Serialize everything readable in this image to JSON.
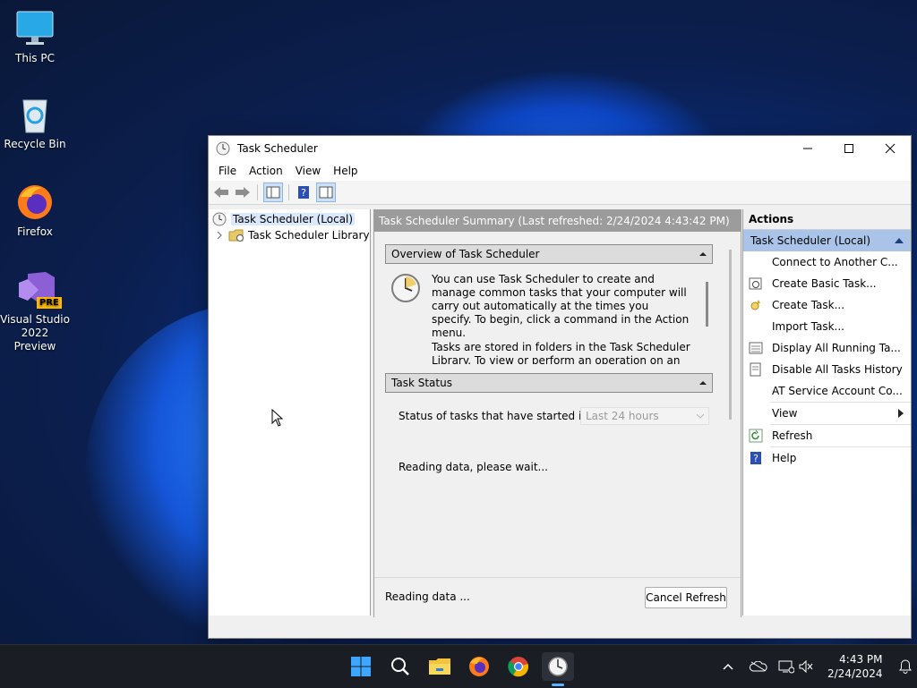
{
  "desktop": {
    "icons": [
      {
        "label": "This PC"
      },
      {
        "label": "Recycle Bin"
      },
      {
        "label": "Firefox"
      },
      {
        "label": "Visual Studio 2022 Preview",
        "badge": "PRE"
      }
    ]
  },
  "window": {
    "title": "Task Scheduler",
    "menu": [
      "File",
      "Action",
      "View",
      "Help"
    ],
    "tree": {
      "root": "Task Scheduler (Local)",
      "library": "Task Scheduler Library"
    },
    "summary": {
      "header": "Task Scheduler Summary (Last refreshed: 2/24/2024 4:43:42 PM)",
      "overview_title": "Overview of Task Scheduler",
      "overview_p1": "You can use Task Scheduler to create and manage common tasks that your computer will carry out automatically at the times you specify. To begin, click a command in the Action menu.",
      "overview_p2": "Tasks are stored in folders in the Task Scheduler Library. To view or perform an operation on an",
      "status_title": "Task Status",
      "status_label": "Status of tasks that have started in t...",
      "status_select": "Last 24 hours",
      "reading_wait": "Reading data, please wait...",
      "reading_status": "Reading data ...",
      "cancel_refresh": "Cancel Refresh"
    },
    "actions": {
      "header": "Actions",
      "section": "Task Scheduler (Local)",
      "items": [
        "Connect to Another C...",
        "Create Basic Task...",
        "Create Task...",
        "Import Task...",
        "Display All Running Ta...",
        "Disable All Tasks History",
        "AT Service Account Co...",
        "View",
        "Refresh",
        "Help"
      ]
    }
  },
  "taskbar": {
    "time": "4:43 PM",
    "date": "2/24/2024"
  },
  "colors": {
    "accent_selection": "#a9c4e8",
    "summary_header": "#9c9c9c",
    "taskbar": "#1a1d24"
  }
}
